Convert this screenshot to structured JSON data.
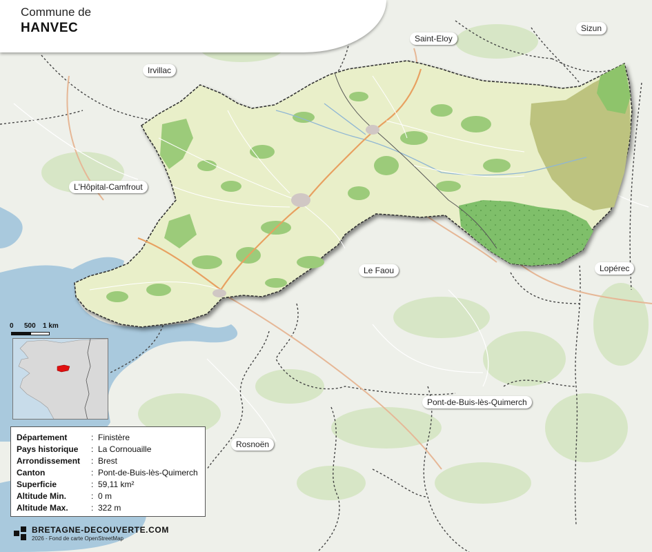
{
  "title": {
    "subtitle": "Commune de",
    "name": "HANVEC"
  },
  "places": {
    "irvillac": "Irvillac",
    "saint_eloy": "Saint-Eloy",
    "sizun": "Sizun",
    "hopital_camfrout": "L'Hôpital-Camfrout",
    "le_faou": "Le Faou",
    "loperec": "Lopérec",
    "pont_de_buis": "Pont-de-Buis-lès-Quimerch",
    "rosnoen": "Rosnoën"
  },
  "scale": {
    "zero": "0",
    "mid": "500",
    "end": "1 km"
  },
  "info": {
    "rows": [
      {
        "key": "Département",
        "value": "Finistère"
      },
      {
        "key": "Pays historique",
        "value": "La Cornouaille"
      },
      {
        "key": "Arrondissement",
        "value": "Brest"
      },
      {
        "key": "Canton",
        "value": "Pont-de-Buis-lès-Quimerch"
      },
      {
        "key": "Superficie",
        "value": "59,11 km²"
      },
      {
        "key": "Altitude Min.",
        "value": "0 m"
      },
      {
        "key": "Altitude Max.",
        "value": "322 m"
      }
    ]
  },
  "footer": {
    "brand": "BRETAGNE-DECOUVERTE.COM",
    "credit": "2026 - Fond de carte OpenStreetMap"
  },
  "colors": {
    "commune_fill": "#e9efc9",
    "forest": "#9ccb7a",
    "dense_forest": "#7fbf6a",
    "water": "#a9c9dd",
    "boundary": "#333333",
    "road": "#e8a060",
    "inset_highlight": "#e01010"
  }
}
